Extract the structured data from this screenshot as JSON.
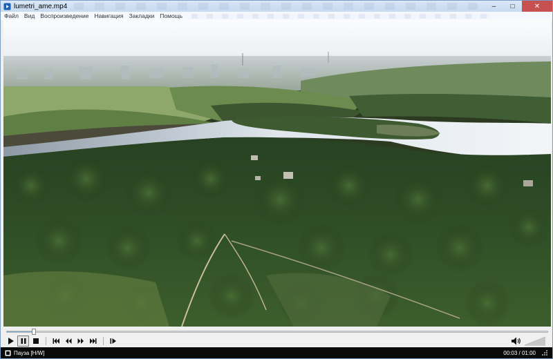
{
  "window": {
    "title": "lumetri_ame.mp4",
    "buttons": {
      "minimize": "–",
      "maximize": "□",
      "close": "✕"
    }
  },
  "menu": {
    "items": [
      "Файл",
      "Вид",
      "Воспроизведение",
      "Навигация",
      "Закладки",
      "Помощь"
    ]
  },
  "player": {
    "progress": 0.05,
    "controls": {
      "play": "▶",
      "pause": "❚❚",
      "stop": "■",
      "skip_back": "⏮",
      "rewind": "◀◀",
      "forward": "▶▶",
      "skip_forward": "⏭",
      "frame_step": "❙▶"
    },
    "volume": 1.0
  },
  "status": {
    "text": "Пауза [H/W]",
    "time": "00:03 / 01:00"
  },
  "colors": {
    "titlebar": "#c7daf0",
    "close_button": "#c75050",
    "status_bg": "#0a0a0a",
    "seek_fill": "#7ba8d8"
  }
}
